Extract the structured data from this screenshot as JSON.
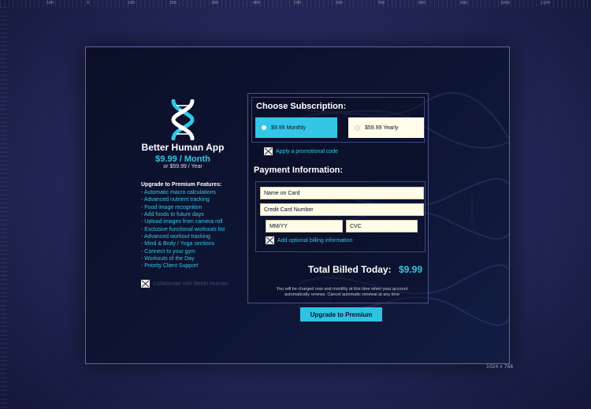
{
  "ruler": {
    "marks": [
      "-100",
      "0",
      "100",
      "200",
      "300",
      "400",
      "500",
      "600",
      "700",
      "800",
      "900",
      "1000",
      "1100"
    ]
  },
  "canvas_size_label": "1024 x 768",
  "app": {
    "name": "Better Human App",
    "price": "$9.99 / Month",
    "price_alt": "or $59.99 / Year",
    "features_title": "Upgrade to Premium Features:",
    "features": [
      "- Automatic macro calculations",
      "- Advanced nutrient tracking",
      "- Food image recognition",
      "- Add foods to future days",
      "- Upload images from camera roll",
      "- Exclusive functional workouts list",
      "- Advanced workout tracking",
      "- Mind & Body / Yoga sections",
      "- Connect to your gym",
      "- Workouts of the Day",
      "- Priority Client Support"
    ],
    "collab_label": "Collaborate with Better Human"
  },
  "subscription": {
    "heading": "Choose Subscription:",
    "monthly_label": "$9.99 Monthly",
    "yearly_label": "$59.99 Yearly",
    "selected": "monthly",
    "promo_link": "Apply a promotional code"
  },
  "payment": {
    "heading": "Payment Information:",
    "name_placeholder": "Name on Card",
    "card_placeholder": "Credit Card Number",
    "expiry_placeholder": "MM/YY",
    "cvc_placeholder": "CVC",
    "billing_link": "Add optional billing information"
  },
  "total": {
    "label": "Total Billed Today:",
    "value": "$9.99",
    "note": "You will be charged now and monthly at this time when your account automatically renews. Cancel automatic renewal at any time"
  },
  "cta_label": "Upgrade to Premium",
  "colors": {
    "accent": "#35c6e6",
    "field_bg": "#fffce8",
    "bg_dark": "#0b1028"
  }
}
